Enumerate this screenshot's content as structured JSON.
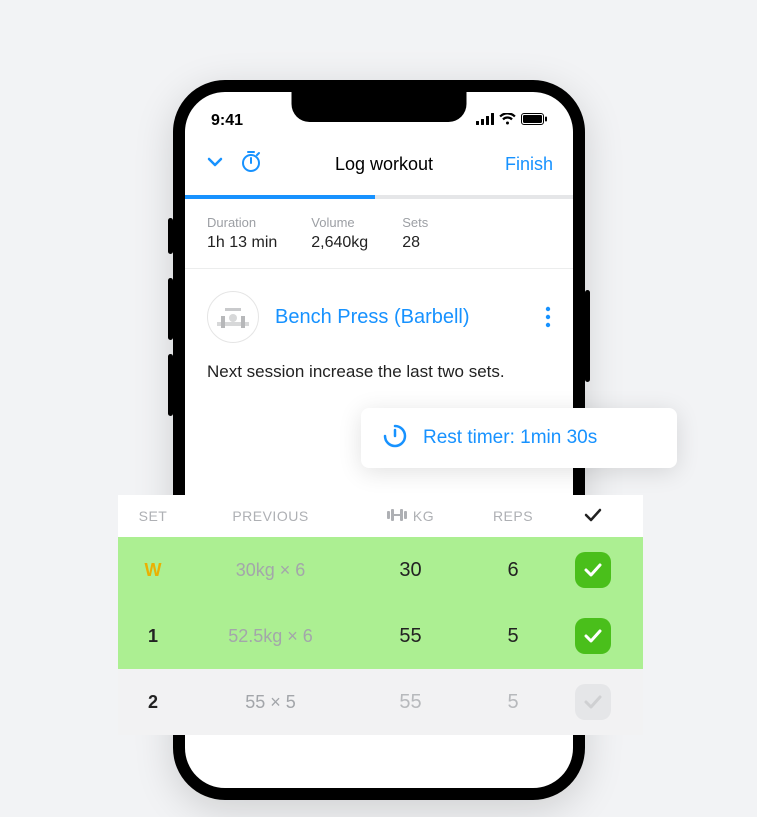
{
  "status": {
    "time": "9:41"
  },
  "header": {
    "title": "Log workout",
    "finish": "Finish"
  },
  "stats": {
    "duration_label": "Duration",
    "duration_value": "1h 13 min",
    "volume_label": "Volume",
    "volume_value": "2,640kg",
    "sets_label": "Sets",
    "sets_value": "28"
  },
  "exercise": {
    "name": "Bench Press (Barbell)",
    "note": "Next session increase the last two sets."
  },
  "rest_timer": {
    "text": "Rest timer: 1min 30s"
  },
  "table": {
    "headers": {
      "set": "SET",
      "previous": "PREVIOUS",
      "kg": "KG",
      "reps": "REPS"
    },
    "rows": [
      {
        "set": "W",
        "set_class": "set-w",
        "previous": "30kg × 6",
        "kg": "30",
        "reps": "6",
        "done": true
      },
      {
        "set": "1",
        "set_class": "set-n",
        "previous": "52.5kg × 6",
        "kg": "55",
        "reps": "5",
        "done": true
      },
      {
        "set": "2",
        "set_class": "set-n",
        "previous": "55 × 5",
        "kg": "55",
        "reps": "5",
        "done": false
      }
    ]
  },
  "colors": {
    "accent": "#1792ff",
    "done_bg": "#acef92",
    "check_green": "#4abf1b"
  }
}
